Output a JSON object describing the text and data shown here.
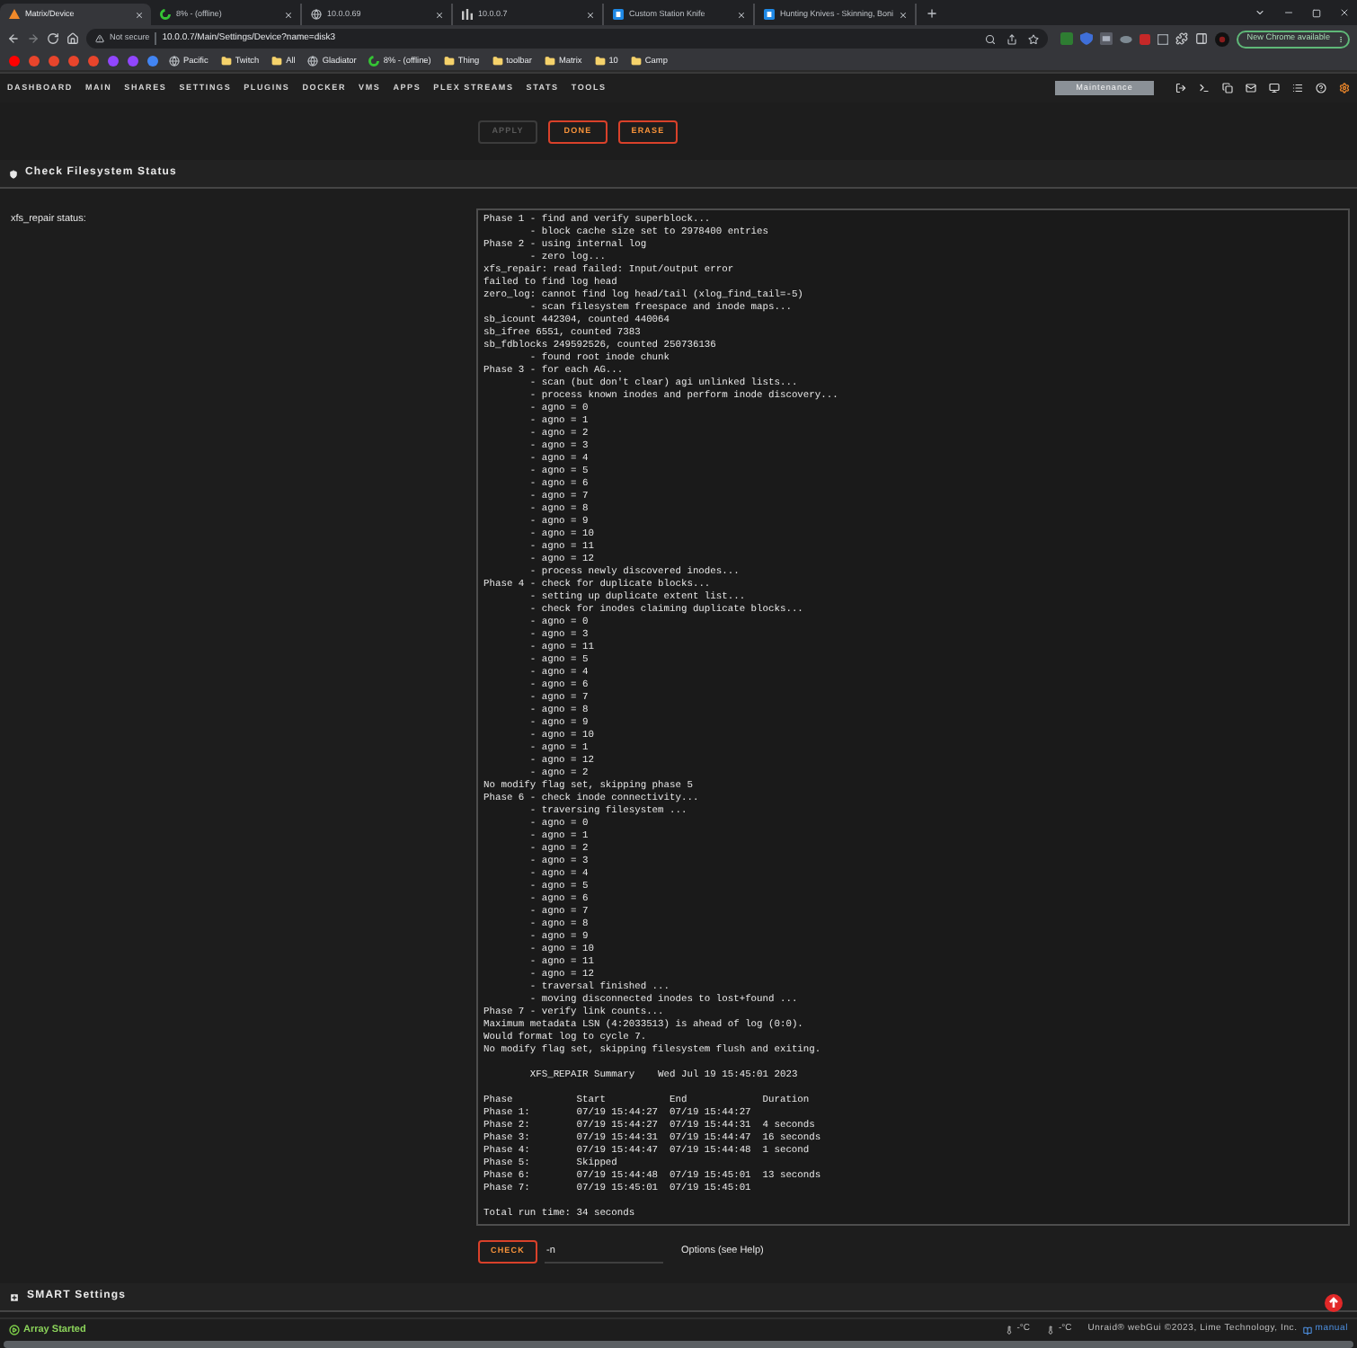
{
  "browser": {
    "tabs": [
      {
        "title": "Matrix/Device",
        "selected": true,
        "kind": "triangle"
      },
      {
        "title": "8% - (offline)",
        "selected": false,
        "kind": "ring"
      },
      {
        "title": "10.0.0.69",
        "selected": false,
        "kind": "globe"
      },
      {
        "title": "10.0.0.7",
        "selected": false,
        "kind": "bars"
      },
      {
        "title": "Custom Station Knife",
        "selected": false,
        "kind": "tile"
      },
      {
        "title": "Hunting Knives - Skinning, Boni",
        "selected": false,
        "kind": "tile"
      }
    ],
    "address_bar": {
      "security": "Not secure",
      "url": "10.0.0.7/Main/Settings/Device?name=disk3"
    },
    "update_button": "New Chrome available",
    "bookmarks": [
      {
        "kind": "favicon",
        "color": "#ff0000"
      },
      {
        "kind": "favicon",
        "color": "#e8452c"
      },
      {
        "kind": "favicon",
        "color": "#e8452c"
      },
      {
        "kind": "favicon",
        "color": "#e8452c"
      },
      {
        "kind": "favicon",
        "color": "#e8452c"
      },
      {
        "kind": "favicon",
        "color": "#9146ff"
      },
      {
        "kind": "favicon",
        "color": "#9146ff"
      },
      {
        "kind": "favicon",
        "color": "#4285f4"
      },
      {
        "kind": "site",
        "label": "Pacific"
      },
      {
        "kind": "folder",
        "label": "Twitch"
      },
      {
        "kind": "folder",
        "label": "All"
      },
      {
        "kind": "site",
        "label": "Gladiator"
      },
      {
        "kind": "ring",
        "label": "8% - (offline)"
      },
      {
        "kind": "folder",
        "label": "Thing"
      },
      {
        "kind": "folder",
        "label": "toolbar"
      },
      {
        "kind": "folder",
        "label": "Matrix"
      },
      {
        "kind": "folder",
        "label": "10"
      },
      {
        "kind": "folder",
        "label": "Camp"
      }
    ]
  },
  "nav": {
    "items": [
      "DASHBOARD",
      "MAIN",
      "SHARES",
      "SETTINGS",
      "PLUGINS",
      "DOCKER",
      "VMS",
      "APPS",
      "PLEX STREAMS",
      "STATS",
      "TOOLS"
    ],
    "badge": "Maintenance"
  },
  "buttons": [
    {
      "label": "APPLY",
      "disabled": true
    },
    {
      "label": "DONE",
      "disabled": false
    },
    {
      "label": "ERASE",
      "disabled": false
    }
  ],
  "check_section": {
    "title": "Check Filesystem Status",
    "collapsed": false,
    "status_label": "xfs_repair status:",
    "log": [
      {
        "text": "Phase 1 - find and verify superblock...",
        "children": [
          "- block cache size set to 2978400 entries"
        ]
      },
      {
        "text": "Phase 2 - using internal log",
        "children": [
          "- zero log..."
        ]
      },
      {
        "text": "xfs_repair: read failed: Input/output error"
      },
      {
        "text": "failed to find log head"
      },
      {
        "text": "zero_log: cannot find log head/tail (xlog_find_tail=-5)",
        "children": [
          "- scan filesystem freespace and inode maps..."
        ]
      },
      {
        "text": "sb_icount 442304, counted 440064"
      },
      {
        "text": "sb_ifree 6551, counted 7383"
      },
      {
        "text": "sb_fdblocks 249592526, counted 250736136",
        "children": [
          "- found root inode chunk"
        ]
      },
      {
        "text": "Phase 3 - for each AG...",
        "children": [
          "- scan (but don't clear) agi unlinked lists...",
          "- process known inodes and perform inode discovery...",
          "- agno = 0",
          "- agno = 1",
          "- agno = 2",
          "- agno = 3",
          "- agno = 4",
          "- agno = 5",
          "- agno = 6",
          "- agno = 7",
          "- agno = 8",
          "- agno = 9",
          "- agno = 10",
          "- agno = 11",
          "- agno = 12",
          "- process newly discovered inodes..."
        ]
      },
      {
        "text": "Phase 4 - check for duplicate blocks...",
        "children": [
          "- setting up duplicate extent list...",
          "- check for inodes claiming duplicate blocks...",
          "- agno = 0",
          "- agno = 3",
          "- agno = 11",
          "- agno = 5",
          "- agno = 4",
          "- agno = 6",
          "- agno = 7",
          "- agno = 8",
          "- agno = 9",
          "- agno = 10",
          "- agno = 1",
          "- agno = 12",
          "- agno = 2"
        ]
      },
      {
        "text": "No modify flag set, skipping phase 5"
      },
      {
        "text": "Phase 6 - check inode connectivity...",
        "children": [
          "- traversing filesystem ...",
          "- agno = 0",
          "- agno = 1",
          "- agno = 2",
          "- agno = 3",
          "- agno = 4",
          "- agno = 5",
          "- agno = 6",
          "- agno = 7",
          "- agno = 8",
          "- agno = 9",
          "- agno = 10",
          "- agno = 11",
          "- agno = 12",
          "- traversal finished ...",
          "- moving disconnected inodes to lost+found ..."
        ]
      },
      {
        "text": "Phase 7 - verify link counts..."
      },
      {
        "text": "Maximum metadata LSN (4:2033513) is ahead of log (0:0)."
      },
      {
        "text": "Would format log to cycle 7."
      },
      {
        "text": "No modify flag set, skipping filesystem flush and exiting."
      }
    ],
    "summary": {
      "title": "XFS_REPAIR Summary",
      "date": "Wed Jul 19 15:45:01 2023",
      "columns": [
        "Phase",
        "Start",
        "End",
        "Duration"
      ],
      "rows": [
        [
          "Phase 1:",
          "07/19 15:44:27",
          "07/19 15:44:27"
        ],
        [
          "Phase 2:",
          "07/19 15:44:27",
          "07/19 15:44:31",
          "4 seconds"
        ],
        [
          "Phase 3:",
          "07/19 15:44:31",
          "07/19 15:44:47",
          "16 seconds"
        ],
        [
          "Phase 4:",
          "07/19 15:44:47",
          "07/19 15:44:48",
          "1 second"
        ],
        [
          "Phase 5:",
          "Skipped"
        ],
        [
          "Phase 6:",
          "07/19 15:44:48",
          "07/19 15:45:01",
          "13 seconds"
        ],
        [
          "Phase 7:",
          "07/19 15:45:01",
          "07/19 15:45:01"
        ]
      ]
    },
    "total": "Total run time: 34 seconds",
    "check_button": "CHECK",
    "options": {
      "value": "-n",
      "help_text": "Options (see Help)"
    }
  },
  "smart_section": {
    "title": "SMART Settings",
    "collapsed": true
  },
  "status_bar": {
    "array_status": "Array Started",
    "temperatures": [
      "-°C",
      "-°C"
    ],
    "copyright": "Unraid® webGui ©2023, Lime Technology, Inc.",
    "manual_link": "manual"
  }
}
